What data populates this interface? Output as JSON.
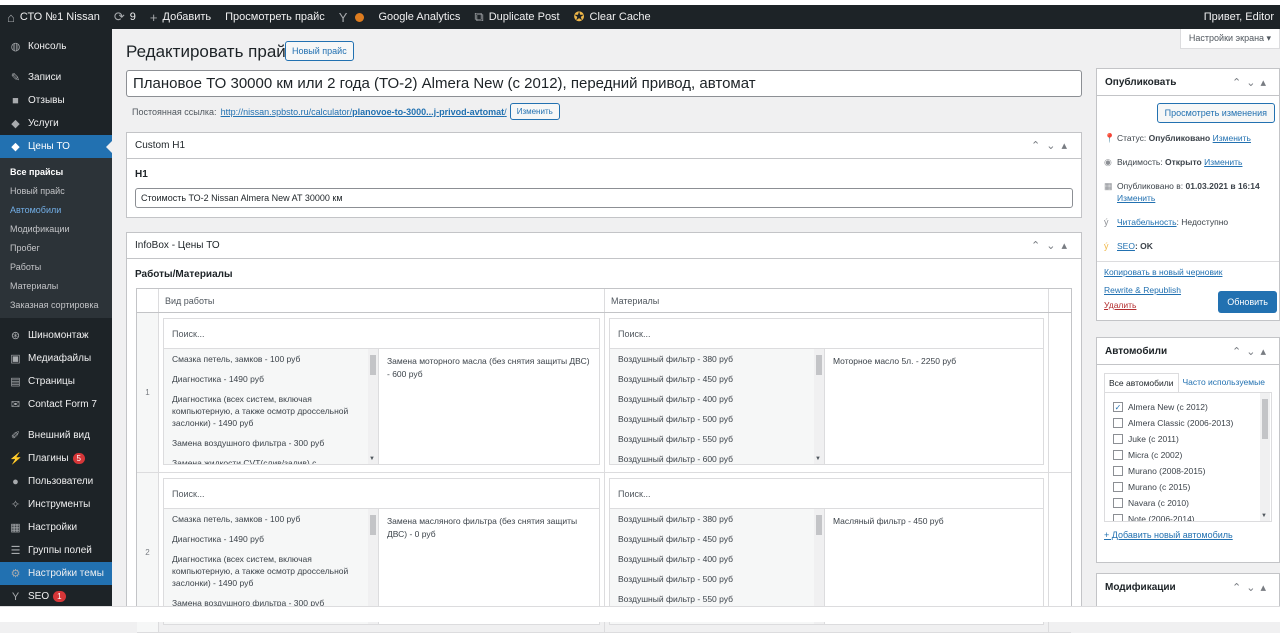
{
  "adminbar": {
    "site_name": "СТО №1 Nissan",
    "updates_count": "9",
    "add_label": "Добавить",
    "view_label": "Просмотреть прайс",
    "ga_label": "Google Analytics",
    "dup_label": "Duplicate Post",
    "cache_label": "Clear Cache",
    "greeting": "Привет, Editor"
  },
  "sidebar": {
    "items_top": [
      {
        "label": "Консоль",
        "icon": "dashboard-icon"
      },
      {
        "label": "Записи",
        "icon": "pin-icon"
      },
      {
        "label": "Отзывы",
        "icon": "comment-icon"
      },
      {
        "label": "Услуги",
        "icon": "tag-icon"
      }
    ],
    "current": {
      "label": "Цены ТО",
      "icon": "tag-icon"
    },
    "submenu": [
      "Все прайсы",
      "Новый прайс",
      "Автомобили",
      "Модификации",
      "Пробег",
      "Работы",
      "Материалы",
      "Заказная сортировка"
    ],
    "items_bottom": [
      {
        "label": "Шиномонтаж",
        "icon": "wheel-icon"
      },
      {
        "label": "Медиафайлы",
        "icon": "media-icon"
      },
      {
        "label": "Страницы",
        "icon": "page-icon"
      },
      {
        "label": "Contact Form 7",
        "icon": "mail-icon"
      },
      {
        "label": "Внешний вид",
        "icon": "brush-icon"
      },
      {
        "label": "Плагины",
        "icon": "plugin-icon",
        "badge": "5"
      },
      {
        "label": "Пользователи",
        "icon": "user-icon"
      },
      {
        "label": "Инструменты",
        "icon": "wrench-icon"
      },
      {
        "label": "Настройки",
        "icon": "settings-icon"
      },
      {
        "label": "Группы полей",
        "icon": "fields-icon"
      },
      {
        "label": "Настройки темы",
        "icon": "gear-icon"
      },
      {
        "label": "SEO",
        "icon": "seo-icon",
        "badge": "1"
      }
    ]
  },
  "screen_options": "Настройки экрана ▾",
  "header": {
    "title": "Редактировать прайс",
    "new_button": "Новый прайс"
  },
  "post": {
    "title": "Плановое ТО 30000 км или 2 года (ТО-2) Almera New (с 2012), передний привод, автомат",
    "permalink_label": "Постоянная ссылка:",
    "permalink_base": "http://nissan.spbsto.ru/calculator/",
    "permalink_slug": "planovoe-to-3000...j-privod-avtomat",
    "permalink_end": "/",
    "edit_slug": "Изменить"
  },
  "custom_h1": {
    "title": "Custom H1",
    "label": "H1",
    "value": "Стоимость ТО-2 Nissan Almera New AT 30000 км"
  },
  "infobox": {
    "title": "InfoBox - Цены ТО",
    "section": "Работы/Материалы",
    "col_works": "Вид работы",
    "col_materials": "Материалы",
    "search_placeholder": "Поиск...",
    "rows": [
      {
        "num": "1",
        "works_list": [
          "Смазка петель, замков - 100 руб",
          "Диагностика - 1490 руб",
          "Диагностика (всех систем, включая компьютерную, а также осмотр дроссельной заслонки) - 1490 руб",
          "Замена воздушного фильтра - 300 руб",
          "Замена жидкости CVT(слив/залив) с"
        ],
        "works_selected": "Замена моторного масла (без снятия защиты ДВС) - 600 руб",
        "mat_list": [
          "Воздушный фильтр - 380 руб",
          "Воздушный фильтр - 450 руб",
          "Воздушный фильтр - 400 руб",
          "Воздушный фильтр - 500 руб",
          "Воздушный фильтр - 550 руб",
          "Воздушный фильтр - 600 руб"
        ],
        "mat_selected": "Моторное масло 5л. - 2250 руб"
      },
      {
        "num": "2",
        "works_list": [
          "Смазка петель, замков - 100 руб",
          "Диагностика - 1490 руб",
          "Диагностика (всех систем, включая компьютерную, а также осмотр дроссельной заслонки) - 1490 руб",
          "Замена воздушного фильтра - 300 руб"
        ],
        "works_selected": "Замена масляного фильтра (без снятия защиты ДВС) - 0 руб",
        "mat_list": [
          "Воздушный фильтр - 380 руб",
          "Воздушный фильтр - 450 руб",
          "Воздушный фильтр - 400 руб",
          "Воздушный фильтр - 500 руб",
          "Воздушный фильтр - 550 руб"
        ],
        "mat_selected": "Масляный фильтр - 450 руб"
      }
    ]
  },
  "publish": {
    "title": "Опубликовать",
    "preview": "Просмотреть изменения",
    "status_label": "Статус:",
    "status_value": "Опубликовано",
    "visibility_label": "Видимость:",
    "visibility_value": "Открыто",
    "published_label": "Опубликовано в:",
    "published_value": "01.03.2021 в 16:14",
    "edit": "Изменить",
    "readability_link": "Читабельность",
    "readability_value": ": Недоступно",
    "seo_link": "SEO",
    "seo_value": ": OK",
    "copy_draft": "Копировать в новый черновик",
    "rewrite": "Rewrite & Republish",
    "delete": "Удалить",
    "update": "Обновить"
  },
  "cars": {
    "title": "Автомобили",
    "tab_all": "Все автомобили",
    "tab_popular": "Часто используемые",
    "items": [
      {
        "label": "Almera New (с 2012)",
        "checked": true
      },
      {
        "label": "Almera Classic (2006-2013)",
        "checked": false
      },
      {
        "label": "Juke (с 2011)",
        "checked": false
      },
      {
        "label": "Micra (с 2002)",
        "checked": false
      },
      {
        "label": "Murano (2008-2015)",
        "checked": false
      },
      {
        "label": "Murano (с 2015)",
        "checked": false
      },
      {
        "label": "Navara (с 2010)",
        "checked": false
      },
      {
        "label": "Note (2006-2014)",
        "checked": false
      }
    ],
    "add_new": "+ Добавить новый автомобиль"
  },
  "mods": {
    "title": "Модификации"
  }
}
